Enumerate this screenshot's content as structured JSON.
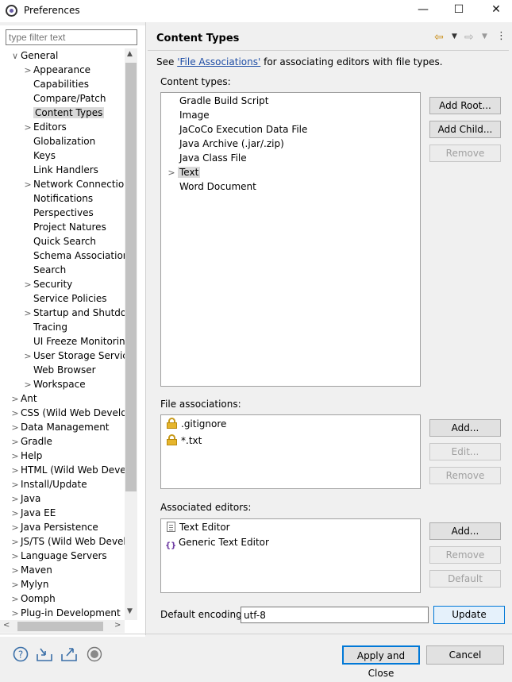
{
  "window": {
    "title": "Preferences",
    "minimize": "—",
    "maximize": "☐",
    "close": "✕"
  },
  "filter": {
    "placeholder": "type filter text"
  },
  "tree": [
    {
      "label": "General",
      "arrow": "∨",
      "indent": 0
    },
    {
      "label": "Appearance",
      "arrow": ">",
      "indent": 1
    },
    {
      "label": "Capabilities",
      "arrow": "",
      "indent": 1
    },
    {
      "label": "Compare/Patch",
      "arrow": "",
      "indent": 1
    },
    {
      "label": "Content Types",
      "arrow": "",
      "indent": 1,
      "selected": true
    },
    {
      "label": "Editors",
      "arrow": ">",
      "indent": 1
    },
    {
      "label": "Globalization",
      "arrow": "",
      "indent": 1
    },
    {
      "label": "Keys",
      "arrow": "",
      "indent": 1
    },
    {
      "label": "Link Handlers",
      "arrow": "",
      "indent": 1
    },
    {
      "label": "Network Connection",
      "arrow": ">",
      "indent": 1
    },
    {
      "label": "Notifications",
      "arrow": "",
      "indent": 1
    },
    {
      "label": "Perspectives",
      "arrow": "",
      "indent": 1
    },
    {
      "label": "Project Natures",
      "arrow": "",
      "indent": 1
    },
    {
      "label": "Quick Search",
      "arrow": "",
      "indent": 1
    },
    {
      "label": "Schema Associations",
      "arrow": "",
      "indent": 1
    },
    {
      "label": "Search",
      "arrow": "",
      "indent": 1
    },
    {
      "label": "Security",
      "arrow": ">",
      "indent": 1
    },
    {
      "label": "Service Policies",
      "arrow": "",
      "indent": 1
    },
    {
      "label": "Startup and Shutdow",
      "arrow": ">",
      "indent": 1
    },
    {
      "label": "Tracing",
      "arrow": "",
      "indent": 1
    },
    {
      "label": "UI Freeze Monitoring",
      "arrow": "",
      "indent": 1
    },
    {
      "label": "User Storage Service",
      "arrow": ">",
      "indent": 1
    },
    {
      "label": "Web Browser",
      "arrow": "",
      "indent": 1
    },
    {
      "label": "Workspace",
      "arrow": ">",
      "indent": 1
    },
    {
      "label": "Ant",
      "arrow": ">",
      "indent": 0
    },
    {
      "label": "CSS (Wild Web Develop",
      "arrow": ">",
      "indent": 0
    },
    {
      "label": "Data Management",
      "arrow": ">",
      "indent": 0
    },
    {
      "label": "Gradle",
      "arrow": ">",
      "indent": 0
    },
    {
      "label": "Help",
      "arrow": ">",
      "indent": 0
    },
    {
      "label": "HTML (Wild Web Devel",
      "arrow": ">",
      "indent": 0
    },
    {
      "label": "Install/Update",
      "arrow": ">",
      "indent": 0
    },
    {
      "label": "Java",
      "arrow": ">",
      "indent": 0
    },
    {
      "label": "Java EE",
      "arrow": ">",
      "indent": 0
    },
    {
      "label": "Java Persistence",
      "arrow": ">",
      "indent": 0
    },
    {
      "label": "JS/TS (Wild Web Develo",
      "arrow": ">",
      "indent": 0
    },
    {
      "label": "Language Servers",
      "arrow": ">",
      "indent": 0
    },
    {
      "label": "Maven",
      "arrow": ">",
      "indent": 0
    },
    {
      "label": "Mylyn",
      "arrow": ">",
      "indent": 0
    },
    {
      "label": "Oomph",
      "arrow": ">",
      "indent": 0
    },
    {
      "label": "Plug-in Development",
      "arrow": ">",
      "indent": 0
    }
  ],
  "page": {
    "title": "Content Types",
    "description_prefix": "See ",
    "description_link": "'File Associations'",
    "description_suffix": " for associating editors with file types."
  },
  "content_types": {
    "label": "Content types:",
    "items": [
      {
        "label": "Gradle Build Script",
        "arrow": ""
      },
      {
        "label": "Image",
        "arrow": ""
      },
      {
        "label": "JaCoCo Execution Data File",
        "arrow": ""
      },
      {
        "label": "Java Archive (.jar/.zip)",
        "arrow": ""
      },
      {
        "label": "Java Class File",
        "arrow": ""
      },
      {
        "label": "Text",
        "arrow": ">",
        "selected": true
      },
      {
        "label": "Word Document",
        "arrow": ""
      }
    ],
    "buttons": {
      "add_root": "Add Root...",
      "add_child": "Add Child...",
      "remove": "Remove"
    }
  },
  "file_associations": {
    "label": "File associations:",
    "items": [
      ".gitignore",
      "*.txt"
    ],
    "buttons": {
      "add": "Add...",
      "edit": "Edit...",
      "remove": "Remove"
    }
  },
  "associated_editors": {
    "label": "Associated editors:",
    "items": [
      "Text Editor",
      "Generic Text Editor"
    ],
    "buttons": {
      "add": "Add...",
      "remove": "Remove",
      "default": "Default"
    }
  },
  "encoding": {
    "label": "Default encoding:",
    "value": "utf-8",
    "update": "Update"
  },
  "footer": {
    "apply_close": "Apply and Close",
    "cancel": "Cancel"
  }
}
